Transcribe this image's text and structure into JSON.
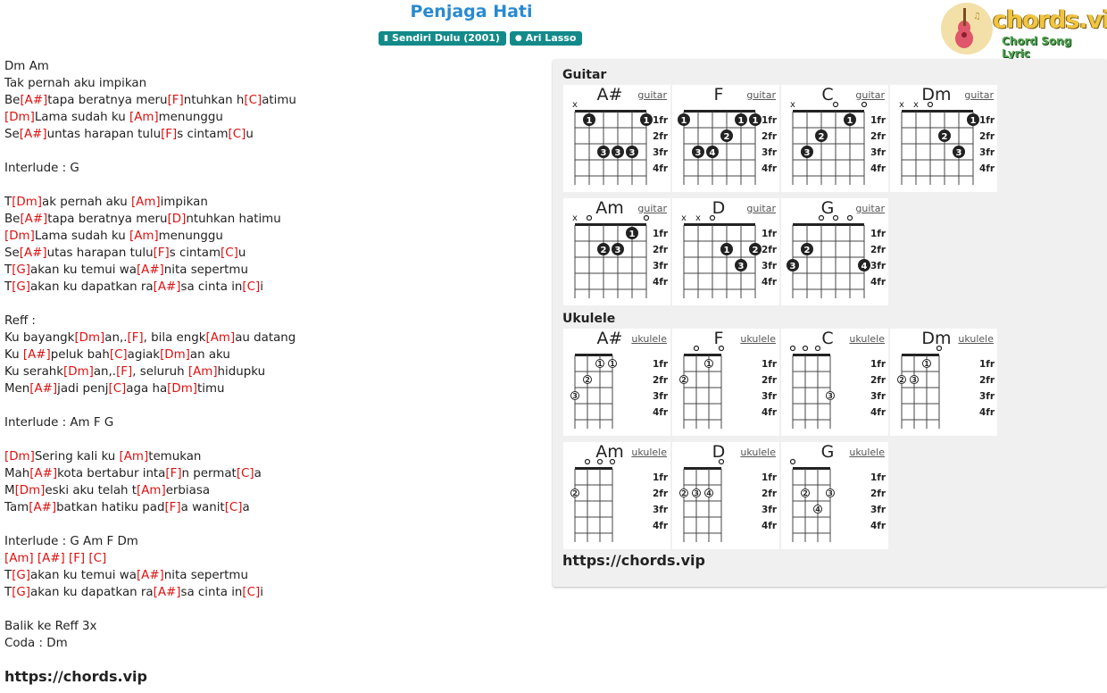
{
  "song": {
    "title": "Penjaga Hati",
    "album": "Sendiri Dulu (2001)",
    "artist": "Ari Lasso"
  },
  "logo": {
    "text": "chords.vip",
    "tagline": "Chord Song Lyric"
  },
  "lyrics": [
    [
      {
        "t": "Dm Am"
      }
    ],
    [
      {
        "t": "Tak pernah aku impikan"
      }
    ],
    [
      {
        "t": "Be"
      },
      {
        "c": "[A#]"
      },
      {
        "t": "tapa beratnya meru"
      },
      {
        "c": "[F]"
      },
      {
        "t": "ntuhkan h"
      },
      {
        "c": "[C]"
      },
      {
        "t": "atimu"
      }
    ],
    [
      {
        "c": "[Dm]"
      },
      {
        "t": "Lama sudah ku "
      },
      {
        "c": "[Am]"
      },
      {
        "t": "menunggu"
      }
    ],
    [
      {
        "t": "Se"
      },
      {
        "c": "[A#]"
      },
      {
        "t": "untas harapan tulu"
      },
      {
        "c": "[F]"
      },
      {
        "t": "s cintam"
      },
      {
        "c": "[C]"
      },
      {
        "t": "u"
      }
    ],
    [
      {
        "t": ""
      }
    ],
    [
      {
        "t": "Interlude : G"
      }
    ],
    [
      {
        "t": ""
      }
    ],
    [
      {
        "t": "T"
      },
      {
        "c": "[Dm]"
      },
      {
        "t": "ak pernah aku "
      },
      {
        "c": "[Am]"
      },
      {
        "t": "impikan"
      }
    ],
    [
      {
        "t": "Be"
      },
      {
        "c": "[A#]"
      },
      {
        "t": "tapa beratnya meru"
      },
      {
        "c": "[D]"
      },
      {
        "t": "ntuhkan hatimu"
      }
    ],
    [
      {
        "c": "[Dm]"
      },
      {
        "t": "Lama sudah ku "
      },
      {
        "c": "[Am]"
      },
      {
        "t": "menunggu"
      }
    ],
    [
      {
        "t": "Se"
      },
      {
        "c": "[A#]"
      },
      {
        "t": "utas harapan tulu"
      },
      {
        "c": "[F]"
      },
      {
        "t": "s cintam"
      },
      {
        "c": "[C]"
      },
      {
        "t": "u"
      }
    ],
    [
      {
        "t": "T"
      },
      {
        "c": "[G]"
      },
      {
        "t": "akan ku temui wa"
      },
      {
        "c": "[A#]"
      },
      {
        "t": "nita sepertmu"
      }
    ],
    [
      {
        "t": "T"
      },
      {
        "c": "[G]"
      },
      {
        "t": "akan ku dapatkan ra"
      },
      {
        "c": "[A#]"
      },
      {
        "t": "sa cinta in"
      },
      {
        "c": "[C]"
      },
      {
        "t": "i"
      }
    ],
    [
      {
        "t": ""
      }
    ],
    [
      {
        "t": "Reff :"
      }
    ],
    [
      {
        "t": "Ku bayangk"
      },
      {
        "c": "[Dm]"
      },
      {
        "t": "an,."
      },
      {
        "c": "[F]"
      },
      {
        "t": ", bila engk"
      },
      {
        "c": "[Am]"
      },
      {
        "t": "au datang"
      }
    ],
    [
      {
        "t": "Ku "
      },
      {
        "c": "[A#]"
      },
      {
        "t": "peluk bah"
      },
      {
        "c": "[C]"
      },
      {
        "t": "agiak"
      },
      {
        "c": "[Dm]"
      },
      {
        "t": "an aku"
      }
    ],
    [
      {
        "t": "Ku serahk"
      },
      {
        "c": "[Dm]"
      },
      {
        "t": "an,."
      },
      {
        "c": "[F]"
      },
      {
        "t": ", seluruh "
      },
      {
        "c": "[Am]"
      },
      {
        "t": "hidupku"
      }
    ],
    [
      {
        "t": "Men"
      },
      {
        "c": "[A#]"
      },
      {
        "t": "jadi penj"
      },
      {
        "c": "[C]"
      },
      {
        "t": "aga ha"
      },
      {
        "c": "[Dm]"
      },
      {
        "t": "timu"
      }
    ],
    [
      {
        "t": ""
      }
    ],
    [
      {
        "t": "Interlude : Am F G"
      }
    ],
    [
      {
        "t": ""
      }
    ],
    [
      {
        "c": "[Dm]"
      },
      {
        "t": "Sering kali ku "
      },
      {
        "c": "[Am]"
      },
      {
        "t": "temukan"
      }
    ],
    [
      {
        "t": "Mah"
      },
      {
        "c": "[A#]"
      },
      {
        "t": "kota bertabur inta"
      },
      {
        "c": "[F]"
      },
      {
        "t": "n permat"
      },
      {
        "c": "[C]"
      },
      {
        "t": "a"
      }
    ],
    [
      {
        "t": "M"
      },
      {
        "c": "[Dm]"
      },
      {
        "t": "eski aku telah t"
      },
      {
        "c": "[Am]"
      },
      {
        "t": "erbiasa"
      }
    ],
    [
      {
        "t": "Tam"
      },
      {
        "c": "[A#]"
      },
      {
        "t": "batkan hatiku pad"
      },
      {
        "c": "[F]"
      },
      {
        "t": "a wanit"
      },
      {
        "c": "[C]"
      },
      {
        "t": "a"
      }
    ],
    [
      {
        "t": ""
      }
    ],
    [
      {
        "t": "Interlude : G Am F Dm"
      }
    ],
    [
      {
        "c": "[Am] [A#] [F] [C]"
      }
    ],
    [
      {
        "t": "T"
      },
      {
        "c": "[G]"
      },
      {
        "t": "akan ku temui wa"
      },
      {
        "c": "[A#]"
      },
      {
        "t": "nita sepertmu"
      }
    ],
    [
      {
        "t": "T"
      },
      {
        "c": "[G]"
      },
      {
        "t": "akan ku dapatkan ra"
      },
      {
        "c": "[A#]"
      },
      {
        "t": "sa cinta in"
      },
      {
        "c": "[C]"
      },
      {
        "t": "i"
      }
    ],
    [
      {
        "t": ""
      }
    ],
    [
      {
        "t": "Balik ke Reff 3x"
      }
    ],
    [
      {
        "t": "Coda : Dm"
      }
    ]
  ],
  "footer_url": "https://chords.vip",
  "panel": {
    "guitar_label": "Guitar",
    "ukulele_label": "Ukulele",
    "url": "https://chords.vip",
    "fret_labels": [
      "1fr",
      "2fr",
      "3fr",
      "4fr"
    ],
    "guitar": [
      {
        "name": "A#",
        "link": "guitar",
        "top": [
          "x",
          "",
          "",
          "",
          "",
          ""
        ],
        "dots": [
          {
            "s": 1,
            "f": 1,
            "n": "1"
          },
          {
            "s": 5,
            "f": 1,
            "n": "1"
          },
          {
            "s": 2,
            "f": 3,
            "n": "3"
          },
          {
            "s": 3,
            "f": 3,
            "n": "3"
          },
          {
            "s": 4,
            "f": 3,
            "n": "3"
          }
        ]
      },
      {
        "name": "F",
        "link": "guitar",
        "top": [
          "",
          "",
          "",
          "",
          "",
          ""
        ],
        "dots": [
          {
            "s": 0,
            "f": 1,
            "n": "1"
          },
          {
            "s": 4,
            "f": 1,
            "n": "1"
          },
          {
            "s": 5,
            "f": 1,
            "n": "1"
          },
          {
            "s": 3,
            "f": 2,
            "n": "2"
          },
          {
            "s": 1,
            "f": 3,
            "n": "3"
          },
          {
            "s": 2,
            "f": 3,
            "n": "4"
          }
        ]
      },
      {
        "name": "C",
        "link": "guitar",
        "top": [
          "x",
          "",
          "",
          "o",
          "",
          "o"
        ],
        "dots": [
          {
            "s": 4,
            "f": 1,
            "n": "1"
          },
          {
            "s": 2,
            "f": 2,
            "n": "2"
          },
          {
            "s": 1,
            "f": 3,
            "n": "3"
          }
        ]
      },
      {
        "name": "Dm",
        "link": "guitar",
        "top": [
          "x",
          "x",
          "o",
          "",
          "",
          ""
        ],
        "dots": [
          {
            "s": 5,
            "f": 1,
            "n": "1"
          },
          {
            "s": 3,
            "f": 2,
            "n": "2"
          },
          {
            "s": 4,
            "f": 3,
            "n": "3"
          }
        ]
      },
      {
        "name": "Am",
        "link": "guitar",
        "top": [
          "x",
          "o",
          "",
          "",
          "",
          "o"
        ],
        "dots": [
          {
            "s": 4,
            "f": 1,
            "n": "1"
          },
          {
            "s": 2,
            "f": 2,
            "n": "2"
          },
          {
            "s": 3,
            "f": 2,
            "n": "3"
          }
        ]
      },
      {
        "name": "D",
        "link": "guitar",
        "top": [
          "x",
          "x",
          "o",
          "",
          "",
          ""
        ],
        "dots": [
          {
            "s": 3,
            "f": 2,
            "n": "1"
          },
          {
            "s": 5,
            "f": 2,
            "n": "2"
          },
          {
            "s": 4,
            "f": 3,
            "n": "3"
          }
        ]
      },
      {
        "name": "G",
        "link": "guitar",
        "top": [
          "",
          "",
          "o",
          "o",
          "o",
          ""
        ],
        "dots": [
          {
            "s": 1,
            "f": 2,
            "n": "2"
          },
          {
            "s": 0,
            "f": 3,
            "n": "3"
          },
          {
            "s": 5,
            "f": 3,
            "n": "4"
          }
        ]
      }
    ],
    "ukulele": [
      {
        "name": "A#",
        "link": "ukulele",
        "top": [
          "",
          "",
          "",
          ""
        ],
        "dots": [
          {
            "s": 2,
            "f": 1,
            "n": "1"
          },
          {
            "s": 3,
            "f": 1,
            "n": "1"
          },
          {
            "s": 1,
            "f": 2,
            "n": "2"
          },
          {
            "s": 0,
            "f": 3,
            "n": "3"
          }
        ]
      },
      {
        "name": "F",
        "link": "ukulele",
        "top": [
          "",
          "o",
          "",
          "o"
        ],
        "dots": [
          {
            "s": 2,
            "f": 1,
            "n": "1"
          },
          {
            "s": 0,
            "f": 2,
            "n": "2"
          }
        ]
      },
      {
        "name": "C",
        "link": "ukulele",
        "top": [
          "o",
          "o",
          "o",
          ""
        ],
        "dots": [
          {
            "s": 3,
            "f": 3,
            "n": "3"
          }
        ]
      },
      {
        "name": "Dm",
        "link": "ukulele",
        "top": [
          "",
          "",
          "",
          "o"
        ],
        "dots": [
          {
            "s": 2,
            "f": 1,
            "n": "1"
          },
          {
            "s": 0,
            "f": 2,
            "n": "2"
          },
          {
            "s": 1,
            "f": 2,
            "n": "3"
          }
        ]
      },
      {
        "name": "Am",
        "link": "ukulele",
        "top": [
          "",
          "o",
          "o",
          "o"
        ],
        "dots": [
          {
            "s": 0,
            "f": 2,
            "n": "2"
          }
        ]
      },
      {
        "name": "D",
        "link": "ukulele",
        "top": [
          "",
          "",
          "",
          "o"
        ],
        "dots": [
          {
            "s": 0,
            "f": 2,
            "n": "2"
          },
          {
            "s": 1,
            "f": 2,
            "n": "3"
          },
          {
            "s": 2,
            "f": 2,
            "n": "4"
          }
        ]
      },
      {
        "name": "G",
        "link": "ukulele",
        "top": [
          "o",
          "",
          "",
          ""
        ],
        "dots": [
          {
            "s": 1,
            "f": 2,
            "n": "2"
          },
          {
            "s": 3,
            "f": 2,
            "n": "3"
          },
          {
            "s": 2,
            "f": 3,
            "n": "4"
          }
        ]
      }
    ]
  }
}
